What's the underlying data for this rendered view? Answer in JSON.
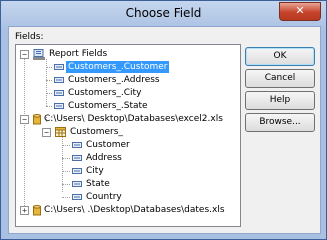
{
  "window": {
    "title": "Choose Field",
    "close_glyph": "✕"
  },
  "fields_label": "Fields:",
  "tree": {
    "report_fields": {
      "label": "Report Fields",
      "items": [
        "Customers_.Customer",
        "Customers_.Address",
        "Customers_.City",
        "Customers_.State"
      ]
    },
    "excel2": {
      "path": "C:\\Users\\                 Desktop\\Databases\\excel2.xls",
      "table": "Customers_",
      "columns": [
        "Customer",
        "Address",
        "City",
        "State",
        "Country"
      ]
    },
    "dates": {
      "path": "C:\\Users\\            .\\Desktop\\Databases\\dates.xls"
    }
  },
  "buttons": {
    "ok": "OK",
    "cancel": "Cancel",
    "help": "Help",
    "browse": "Browse..."
  },
  "colors": {
    "selection": "#3399ff",
    "close": "#c6432a",
    "db": "#e8b53b"
  }
}
